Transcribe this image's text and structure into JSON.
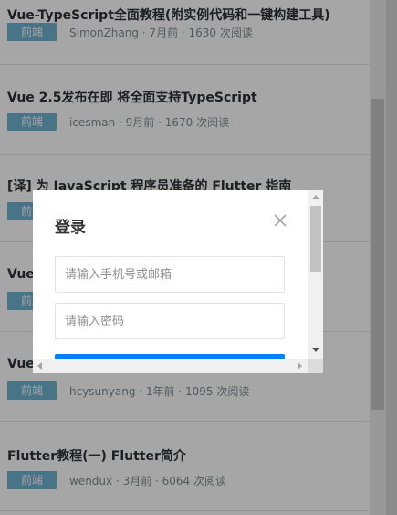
{
  "articles": [
    {
      "title": "Vue-TypeScript全面教程(附实例代码和一键构建工具)",
      "tag": "前端",
      "meta": "SimonZhang · 7月前 · 1630 次阅读"
    },
    {
      "title": "Vue 2.5发布在即 将全面支持TypeScript",
      "tag": "前端",
      "meta": "icesman · 9月前 · 1670 次阅读"
    },
    {
      "title": "[译] 为 JavaScript 程序员准备的 Flutter 指南",
      "tag": "前端",
      "meta": ""
    },
    {
      "title": "Vue",
      "tag": "前端",
      "meta": ""
    },
    {
      "title": "Vue",
      "tag": "前端",
      "meta": "hcysunyang · 1年前 · 1095 次阅读"
    },
    {
      "title": "Flutter教程(一) Flutter简介",
      "tag": "前端",
      "meta": "wendux · 3月前 · 6064 次阅读"
    }
  ],
  "login": {
    "title": "登录",
    "phone_placeholder": "请输入手机号或邮箱",
    "password_placeholder": "请输入密码"
  },
  "colors": {
    "tag": "#6fb3d2",
    "primary": "#007fff",
    "title_text": "#2e3135",
    "meta_text": "#7f8c8d"
  },
  "icons": {
    "close": "close-icon",
    "mascot": "mascot-ears-icon"
  }
}
